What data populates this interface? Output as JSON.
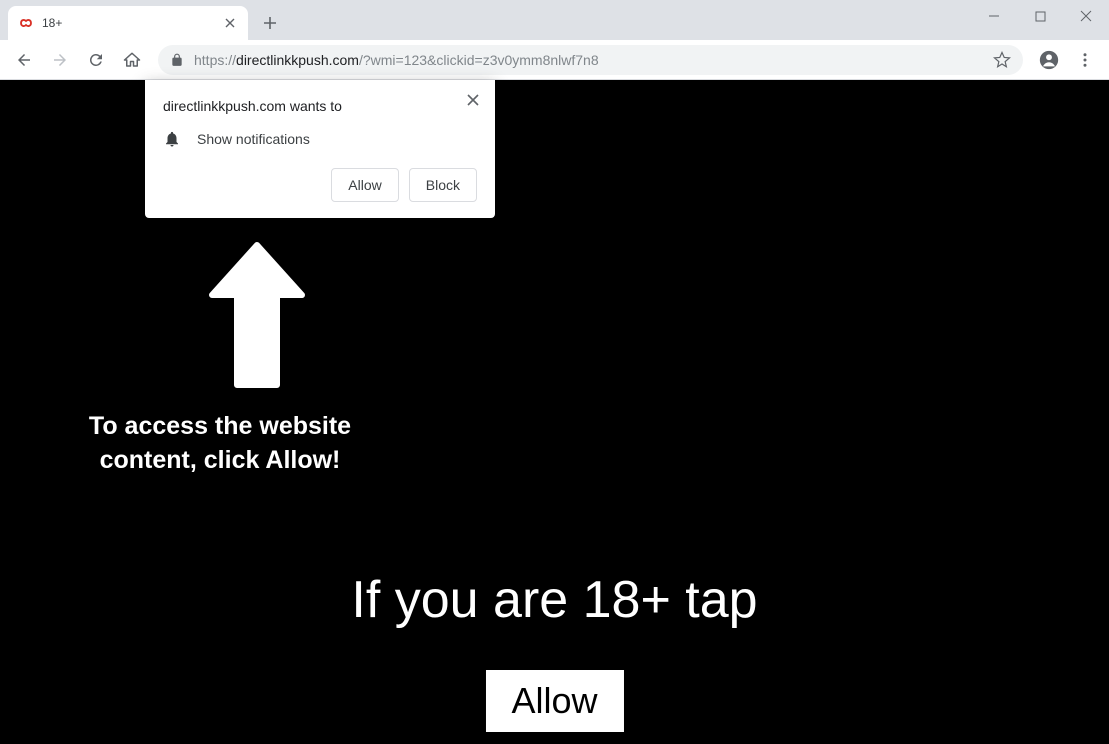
{
  "browser": {
    "tab": {
      "title": "18+"
    },
    "url": {
      "scheme": "https://",
      "domain": "directlinkkpush.com",
      "path": "/?wmi=123&clickid=z3v0ymm8nlwf7n8"
    }
  },
  "permission_popup": {
    "title": "directlinkkpush.com wants to",
    "item_label": "Show notifications",
    "allow_label": "Allow",
    "block_label": "Block"
  },
  "page": {
    "instruction": "To access the website content, click Allow!",
    "age_line": "If you are 18+ tap",
    "button_label": "Allow"
  }
}
